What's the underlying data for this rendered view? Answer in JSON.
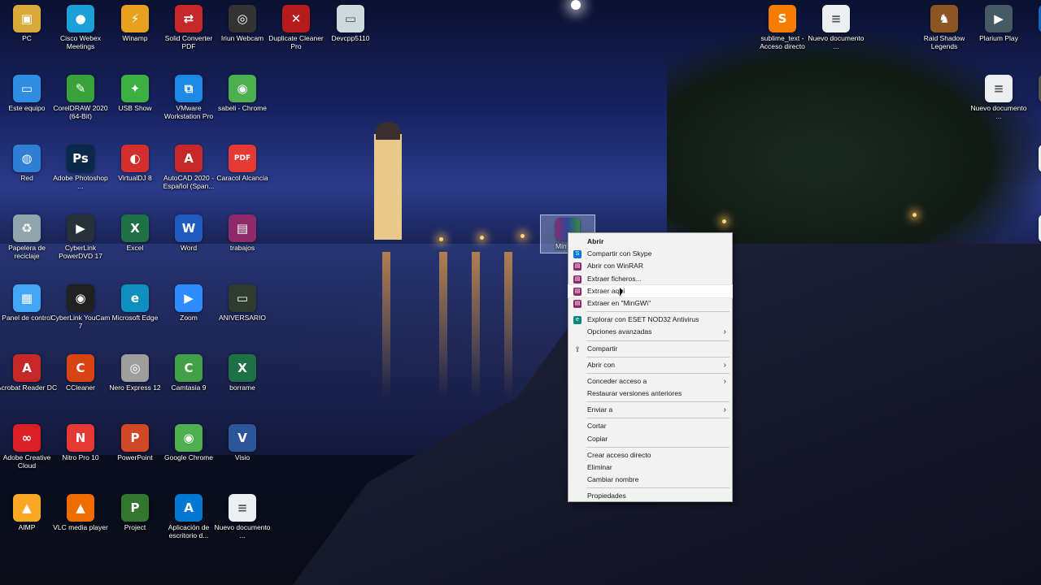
{
  "desktop": {
    "icons": [
      {
        "label": "PC",
        "icon": "folder-user-icon",
        "color": "#d9a93a",
        "sym": "▣"
      },
      {
        "label": "Cisco Webex Meetings",
        "icon": "webex-icon",
        "color": "#1ba0d7",
        "sym": "●"
      },
      {
        "label": "Winamp",
        "icon": "winamp-icon",
        "color": "#e8a020",
        "sym": "⚡"
      },
      {
        "label": "Solid Converter PDF",
        "icon": "pdf-converter-icon",
        "color": "#c62828",
        "sym": "⇄"
      },
      {
        "label": "Iriun Webcam",
        "icon": "webcam-icon",
        "color": "#333333",
        "sym": "◎"
      },
      {
        "label": "Duplicate Cleaner Pro",
        "icon": "duplicate-cleaner-icon",
        "color": "#b71c1c",
        "sym": "✕"
      },
      {
        "label": "Devcpp5110",
        "icon": "devcpp-icon",
        "color": "#cfd8dc",
        "sym": "▭"
      },
      {
        "label": "Este equipo",
        "icon": "this-pc-icon",
        "color": "#2f8de4",
        "sym": "▭"
      },
      {
        "label": "CorelDRAW 2020 (64-Bit)",
        "icon": "coreldraw-icon",
        "color": "#3aa23a",
        "sym": "✎"
      },
      {
        "label": "USB Show",
        "icon": "usb-show-icon",
        "color": "#3cb043",
        "sym": "✦"
      },
      {
        "label": "VMware Workstation Pro",
        "icon": "vmware-icon",
        "color": "#1e88e5",
        "sym": "⧉"
      },
      {
        "label": "sabeli - Chrome",
        "icon": "chrome-icon",
        "color": "#4caf50",
        "sym": "◉"
      },
      {
        "label": "Red",
        "icon": "network-icon",
        "color": "#2f7fd6",
        "sym": "◍"
      },
      {
        "label": "Adobe Photoshop ...",
        "icon": "photoshop-icon",
        "color": "#0b2a4a",
        "sym": "Ps"
      },
      {
        "label": "VirtualDJ 8",
        "icon": "virtualdj-icon",
        "color": "#d32f2f",
        "sym": "◐"
      },
      {
        "label": "AutoCAD 2020 - Español (Span...",
        "icon": "autocad-icon",
        "color": "#c62828",
        "sym": "A"
      },
      {
        "label": "Caracol Alcancia",
        "icon": "pdf-icon",
        "color": "#e53935",
        "sym": "PDF"
      },
      {
        "label": "Papelera de reciclaje",
        "icon": "recycle-bin-icon",
        "color": "#90a4ae",
        "sym": "♻"
      },
      {
        "label": "CyberLink PowerDVD 17",
        "icon": "powerdvd-icon",
        "color": "#263238",
        "sym": "▶"
      },
      {
        "label": "Excel",
        "icon": "excel-icon",
        "color": "#1e7145",
        "sym": "X"
      },
      {
        "label": "Word",
        "icon": "word-icon",
        "color": "#1f5bbf",
        "sym": "W"
      },
      {
        "label": "trabajos",
        "icon": "winrar-icon",
        "color": "#8e2a6a",
        "sym": "▤"
      },
      {
        "label": "Panel de control",
        "icon": "control-panel-icon",
        "color": "#42a5f5",
        "sym": "▦"
      },
      {
        "label": "CyberLink YouCam 7",
        "icon": "youcam-icon",
        "color": "#212121",
        "sym": "◉"
      },
      {
        "label": "Microsoft Edge",
        "icon": "edge-icon",
        "color": "#0f8fbf",
        "sym": "e"
      },
      {
        "label": "Zoom",
        "icon": "zoom-icon",
        "color": "#2d8cff",
        "sym": "▶"
      },
      {
        "label": "ANIVERSARIO",
        "icon": "folder-icon",
        "color": "#2e3b2e",
        "sym": "▭"
      },
      {
        "label": "Acrobat Reader DC",
        "icon": "acrobat-icon",
        "color": "#c62828",
        "sym": "A"
      },
      {
        "label": "CCleaner",
        "icon": "ccleaner-icon",
        "color": "#d84315",
        "sym": "C"
      },
      {
        "label": "Nero Express 12",
        "icon": "nero-icon",
        "color": "#9e9e9e",
        "sym": "◎"
      },
      {
        "label": "Camtasia 9",
        "icon": "camtasia-icon",
        "color": "#43a047",
        "sym": "C"
      },
      {
        "label": "borrame",
        "icon": "excel-file-icon",
        "color": "#1e7145",
        "sym": "X"
      },
      {
        "label": "Adobe Creative Cloud",
        "icon": "creative-cloud-icon",
        "color": "#da1f26",
        "sym": "∞"
      },
      {
        "label": "Nitro Pro 10",
        "icon": "nitro-icon",
        "color": "#e53935",
        "sym": "N"
      },
      {
        "label": "PowerPoint",
        "icon": "powerpoint-icon",
        "color": "#d24726",
        "sym": "P"
      },
      {
        "label": "Google Chrome",
        "icon": "chrome-icon",
        "color": "#4caf50",
        "sym": "◉"
      },
      {
        "label": "Visio",
        "icon": "visio-icon",
        "color": "#2b579a",
        "sym": "V"
      },
      {
        "label": "AIMP",
        "icon": "aimp-icon",
        "color": "#f9a825",
        "sym": "▲"
      },
      {
        "label": "VLC media player",
        "icon": "vlc-icon",
        "color": "#ef6c00",
        "sym": "▲"
      },
      {
        "label": "Project",
        "icon": "project-icon",
        "color": "#31752f",
        "sym": "P"
      },
      {
        "label": "Aplicación de escritorio d...",
        "icon": "azure-icon",
        "color": "#0078d4",
        "sym": "A"
      },
      {
        "label": "Nuevo documento ...",
        "icon": "document-icon",
        "color": "#eceff1",
        "sym": "≡"
      },
      {
        "label": "sublime_text - Acceso directo",
        "icon": "sublime-icon",
        "color": "#f57c00",
        "sym": "S"
      },
      {
        "label": "Nuevo documento ...",
        "icon": "document-icon",
        "color": "#eceff1",
        "sym": "≡"
      },
      {
        "label": "Raid Shadow Legends",
        "icon": "raid-icon",
        "color": "#8d5524",
        "sym": "♞"
      },
      {
        "label": "Plarium Play",
        "icon": "plarium-icon",
        "color": "#455a64",
        "sym": "▶"
      },
      {
        "label": "Nuevo documento ...",
        "icon": "document-icon",
        "color": "#eceff1",
        "sym": "≡"
      },
      {
        "label": "eu",
        "icon": "partial-icon",
        "color": "#1565c0",
        "sym": ""
      },
      {
        "label": "Alie",
        "icon": "partial-icon",
        "color": "#555555",
        "sym": ""
      },
      {
        "label": "doc",
        "icon": "partial-icon",
        "color": "#eceff1",
        "sym": ""
      },
      {
        "label": "doc",
        "icon": "partial-icon",
        "color": "#eceff1",
        "sym": ""
      }
    ],
    "selected_item": {
      "label": "Min",
      "icon": "winrar-archive-icon"
    }
  },
  "context_menu": {
    "items": [
      {
        "type": "item",
        "label": "Abrir",
        "bold": true
      },
      {
        "type": "item",
        "label": "Compartir con Skype",
        "icon": "skype-icon",
        "color": "#0078d4",
        "sym": "S"
      },
      {
        "type": "item",
        "label": "Abrir con WinRAR",
        "icon": "winrar-icon",
        "color": "#8e2a6a",
        "sym": "▤"
      },
      {
        "type": "item",
        "label": "Extraer ficheros...",
        "icon": "winrar-icon",
        "color": "#8e2a6a",
        "sym": "▤"
      },
      {
        "type": "item",
        "label": "Extraer aquí",
        "icon": "winrar-icon",
        "color": "#8e2a6a",
        "sym": "▤",
        "hover": true
      },
      {
        "type": "item",
        "label": "Extraer en \"MinGW\\\"",
        "icon": "winrar-icon",
        "color": "#8e2a6a",
        "sym": "▤"
      },
      {
        "type": "sep"
      },
      {
        "type": "item",
        "label": "Explorar con ESET NOD32 Antivirus",
        "icon": "eset-icon",
        "color": "#00897b",
        "sym": "e"
      },
      {
        "type": "item",
        "label": "Opciones avanzadas",
        "submenu": true
      },
      {
        "type": "sep"
      },
      {
        "type": "item",
        "label": "Compartir",
        "icon": "share-icon",
        "color": "#f2f2f2",
        "sym": "⇪"
      },
      {
        "type": "sep"
      },
      {
        "type": "item",
        "label": "Abrir con",
        "submenu": true
      },
      {
        "type": "sep"
      },
      {
        "type": "item",
        "label": "Conceder acceso a",
        "submenu": true
      },
      {
        "type": "item",
        "label": "Restaurar versiones anteriores"
      },
      {
        "type": "sep"
      },
      {
        "type": "item",
        "label": "Enviar a",
        "submenu": true
      },
      {
        "type": "sep"
      },
      {
        "type": "item",
        "label": "Cortar"
      },
      {
        "type": "item",
        "label": "Copiar"
      },
      {
        "type": "sep"
      },
      {
        "type": "item",
        "label": "Crear acceso directo"
      },
      {
        "type": "item",
        "label": "Eliminar"
      },
      {
        "type": "item",
        "label": "Cambiar nombre"
      },
      {
        "type": "sep"
      },
      {
        "type": "item",
        "label": "Propiedades"
      }
    ]
  }
}
